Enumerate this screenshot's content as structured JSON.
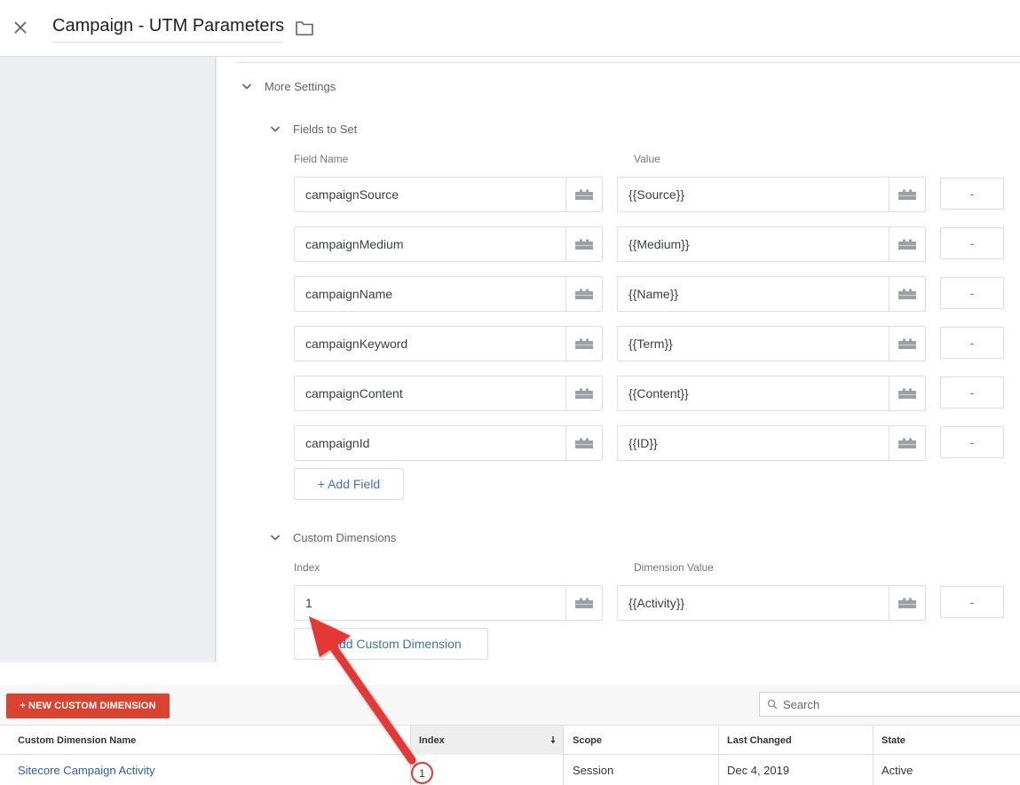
{
  "header": {
    "title": "Campaign - UTM Parameters"
  },
  "more_settings": {
    "label": "More Settings",
    "fields_to_set": {
      "label": "Fields to Set",
      "col_field_name": "Field Name",
      "col_value": "Value",
      "rows": [
        {
          "name": "campaignSource",
          "value": "{{Source}}"
        },
        {
          "name": "campaignMedium",
          "value": "{{Medium}}"
        },
        {
          "name": "campaignName",
          "value": "{{Name}}"
        },
        {
          "name": "campaignKeyword",
          "value": "{{Term}}"
        },
        {
          "name": "campaignContent",
          "value": "{{Content}}"
        },
        {
          "name": "campaignId",
          "value": "{{ID}}"
        }
      ],
      "remove_label": "-",
      "add_label": "+ Add Field"
    },
    "custom_dimensions": {
      "label": "Custom Dimensions",
      "col_index": "Index",
      "col_value": "Dimension Value",
      "rows": [
        {
          "index": "1",
          "value": "{{Activity}}"
        }
      ],
      "remove_label": "-",
      "add_label": "+ Add Custom Dimension"
    }
  },
  "analytics": {
    "new_button": "+ NEW CUSTOM DIMENSION",
    "search_placeholder": "Search",
    "columns": {
      "name": "Custom Dimension Name",
      "index": "Index",
      "scope": "Scope",
      "last_changed": "Last Changed",
      "state": "State"
    },
    "rows": [
      {
        "name": "Sitecore Campaign Activity",
        "index": "1",
        "scope": "Session",
        "last_changed": "Dec 4, 2019",
        "state": "Active"
      }
    ]
  },
  "colors": {
    "accent_link": "#3f6fc4",
    "new_button_bg": "#d9432f",
    "annotation_red": "#e53935"
  }
}
